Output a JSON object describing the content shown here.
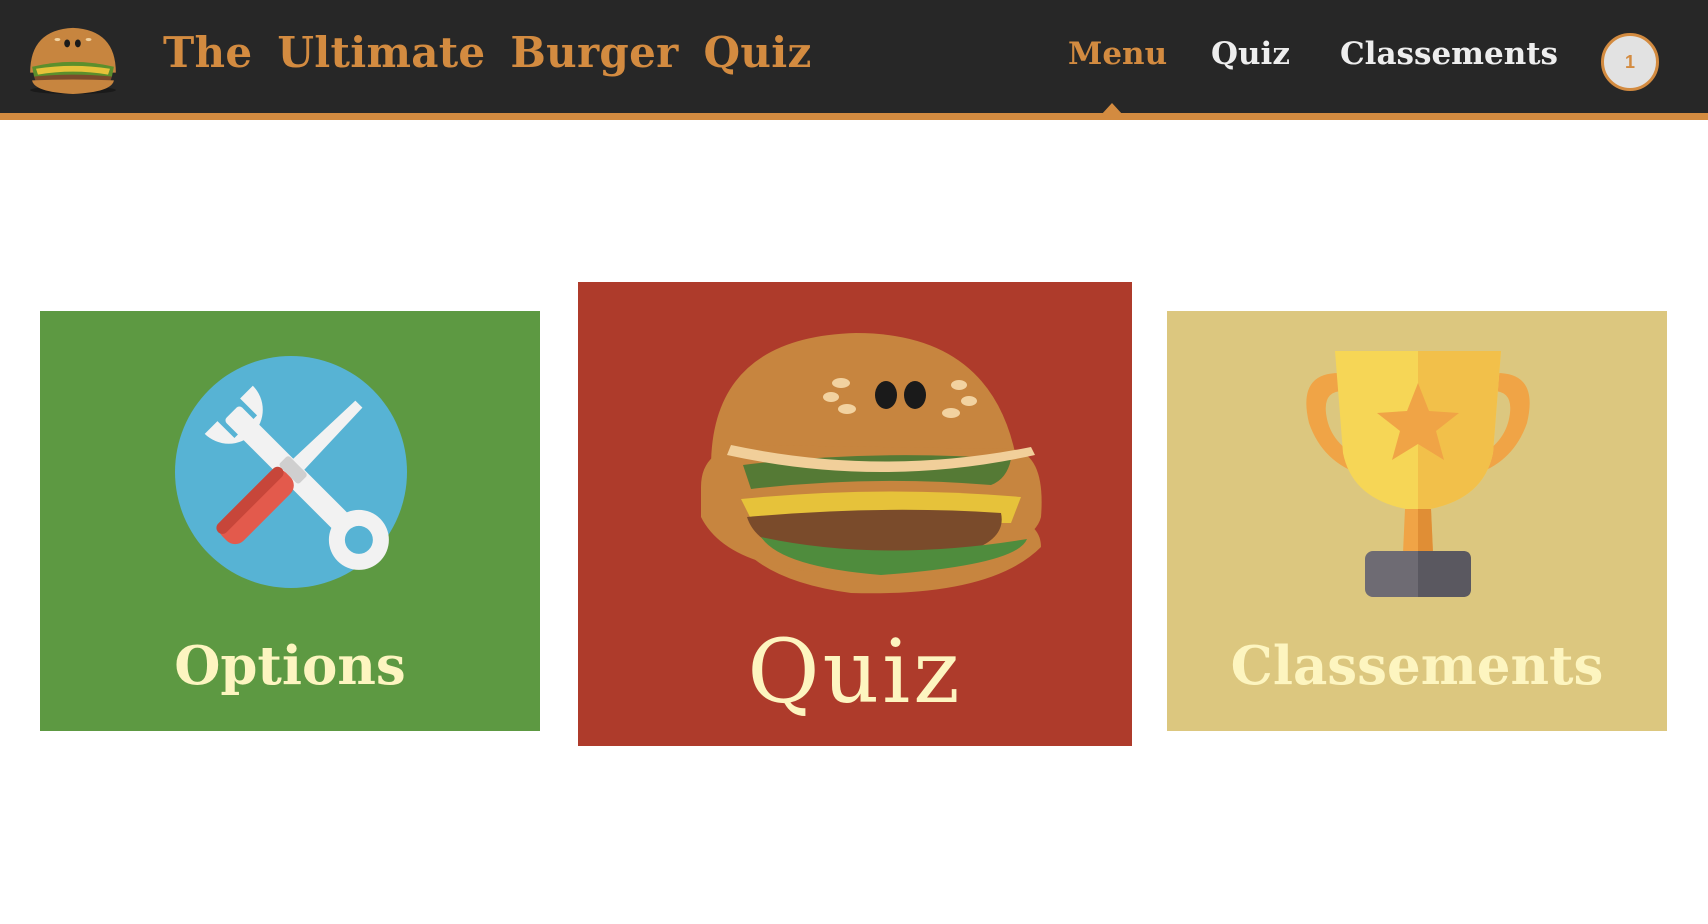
{
  "header": {
    "title": "The Ultimate Burger Quiz",
    "logo_icon": "burger-icon",
    "nav": [
      {
        "label": "Menu",
        "active": true
      },
      {
        "label": "Quiz",
        "active": false
      },
      {
        "label": "Classements",
        "active": false
      }
    ],
    "badge": "1"
  },
  "tiles": [
    {
      "label": "Options",
      "icon": "tools-icon",
      "color": "#5d9942"
    },
    {
      "label": "Quiz",
      "icon": "burger-icon",
      "color": "#ae3b2b"
    },
    {
      "label": "Classements",
      "icon": "trophy-icon",
      "color": "#dcc77f"
    }
  ],
  "colors": {
    "navbar": "#272727",
    "accent": "#d38b40",
    "label_text": "#fdf5c0"
  }
}
